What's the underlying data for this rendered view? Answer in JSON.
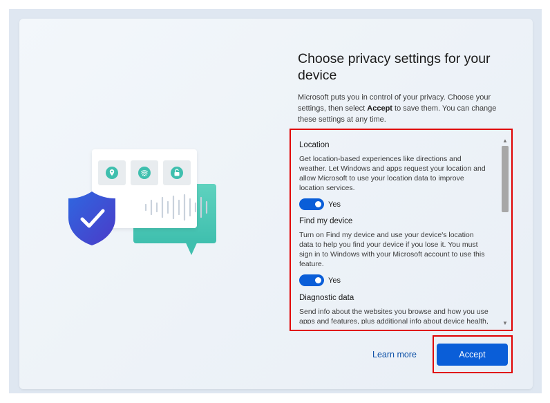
{
  "page": {
    "title": "Choose privacy settings for your device",
    "intro_before": "Microsoft puts you in control of your privacy. Choose your settings, then select ",
    "intro_bold": "Accept",
    "intro_after": " to save them. You can change these settings at any time."
  },
  "settings": [
    {
      "title": "Location",
      "description": "Get location-based experiences like directions and weather. Let Windows and apps request your location and allow Microsoft to use your location data to improve location services.",
      "state": "Yes"
    },
    {
      "title": "Find my device",
      "description": "Turn on Find my device and use your device's location data to help you find your device if you lose it. You must sign in to Windows with your Microsoft account to use this feature.",
      "state": "Yes"
    },
    {
      "title": "Diagnostic data",
      "description": "Send info about the websites you browse and how you use apps and features, plus additional info about device health, device activity, and enhanced error reporting."
    }
  ],
  "footer": {
    "learn_more": "Learn more",
    "accept": "Accept"
  },
  "colors": {
    "accent": "#0a5ed8",
    "highlight": "#e00000",
    "teal": "#3fbfae",
    "shield": "#2d5fd6"
  },
  "icons": [
    "location-pin-icon",
    "fingerprint-icon",
    "unlock-icon",
    "shield-check-icon",
    "voice-wave-icon"
  ]
}
